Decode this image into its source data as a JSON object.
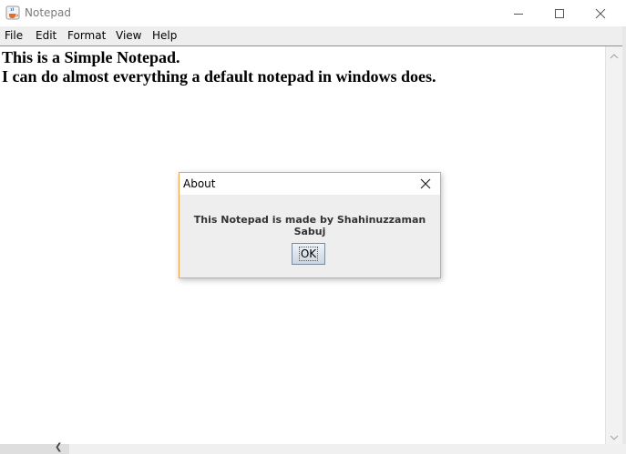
{
  "window": {
    "title": "Notepad",
    "icon": "java-cup-icon"
  },
  "menu": {
    "items": [
      {
        "label": "File"
      },
      {
        "label": "Edit"
      },
      {
        "label": "Format"
      },
      {
        "label": "View"
      },
      {
        "label": "Help"
      }
    ]
  },
  "editor": {
    "lines": [
      "This is a Simple Notepad.",
      "I can do almost everything a default notepad in windows does."
    ]
  },
  "dialog": {
    "title": "About",
    "message": "This Notepad is made by Shahinuzzaman Sabuj",
    "ok_label": "OK"
  },
  "colors": {
    "dialog_border": "#e8a54a",
    "menubar_bg": "#eeeeee"
  }
}
